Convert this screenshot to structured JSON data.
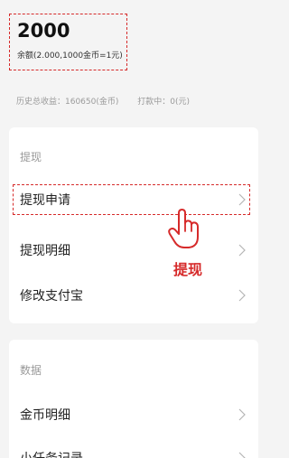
{
  "balance": {
    "amount": "2000",
    "note": "余额(2.000,1000金币=1元)"
  },
  "stats": {
    "history_income": "历史总收益：160650(金币)",
    "processing": "打款中：0(元)"
  },
  "withdraw_section": {
    "title": "提现",
    "items": [
      {
        "label": "提现申请"
      },
      {
        "label": "提现明细"
      },
      {
        "label": "修改支付宝"
      }
    ]
  },
  "data_section": {
    "title": "数据",
    "items": [
      {
        "label": "金币明细"
      },
      {
        "label": "小任务记录"
      }
    ]
  },
  "annotation": {
    "label": "提现",
    "icon": "hand-pointer-icon",
    "color": "#d62a2a"
  }
}
